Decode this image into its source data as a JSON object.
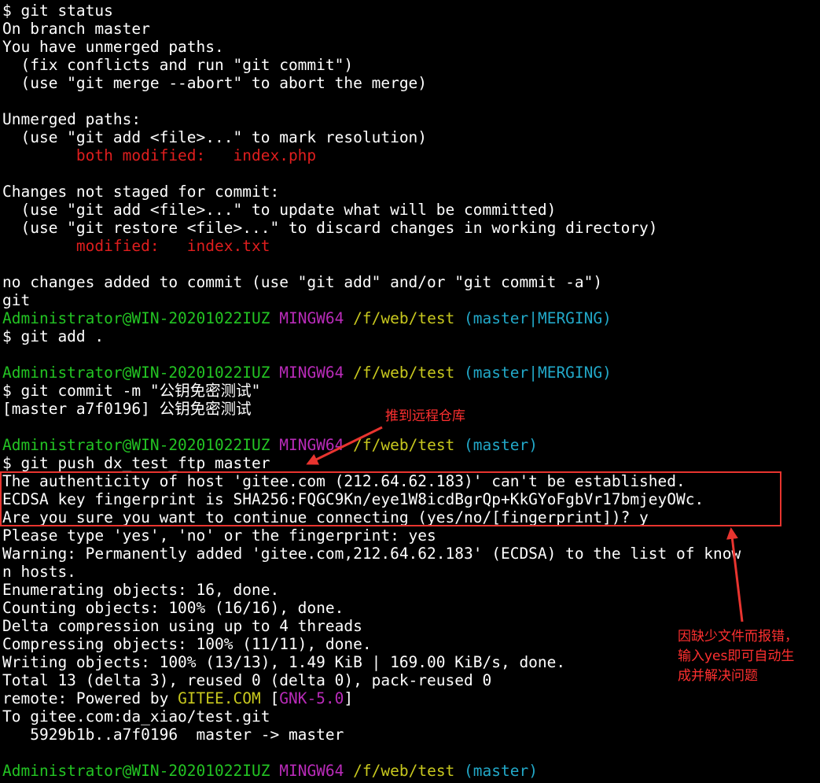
{
  "terminal": {
    "lines": [
      {
        "segments": [
          {
            "t": "$ git status",
            "c": ""
          }
        ]
      },
      {
        "segments": [
          {
            "t": "On branch master",
            "c": ""
          }
        ]
      },
      {
        "segments": [
          {
            "t": "You have unmerged paths.",
            "c": ""
          }
        ]
      },
      {
        "segments": [
          {
            "t": "  (fix conflicts and run \"git commit\")",
            "c": ""
          }
        ]
      },
      {
        "segments": [
          {
            "t": "  (use \"git merge --abort\" to abort the merge)",
            "c": ""
          }
        ]
      },
      {
        "segments": []
      },
      {
        "segments": [
          {
            "t": "Unmerged paths:",
            "c": ""
          }
        ]
      },
      {
        "segments": [
          {
            "t": "  (use \"git add <file>...\" to mark resolution)",
            "c": ""
          }
        ]
      },
      {
        "segments": [
          {
            "t": "        both modified:   index.php",
            "c": "red"
          }
        ]
      },
      {
        "segments": []
      },
      {
        "segments": [
          {
            "t": "Changes not staged for commit:",
            "c": ""
          }
        ]
      },
      {
        "segments": [
          {
            "t": "  (use \"git add <file>...\" to update what will be committed)",
            "c": ""
          }
        ]
      },
      {
        "segments": [
          {
            "t": "  (use \"git restore <file>...\" to discard changes in working directory)",
            "c": ""
          }
        ]
      },
      {
        "segments": [
          {
            "t": "        modified:   index.txt",
            "c": "red"
          }
        ]
      },
      {
        "segments": []
      },
      {
        "segments": [
          {
            "t": "no changes added to commit (use \"git add\" and/or \"git commit -a\")",
            "c": ""
          }
        ]
      },
      {
        "segments": [
          {
            "t": "git",
            "c": ""
          }
        ]
      },
      {
        "segments": [
          {
            "t": "Administrator@WIN-20201022IUZ",
            "c": "green"
          },
          {
            "t": " ",
            "c": ""
          },
          {
            "t": "MINGW64",
            "c": "magenta"
          },
          {
            "t": " ",
            "c": ""
          },
          {
            "t": "/f/web/test",
            "c": "yellow"
          },
          {
            "t": " ",
            "c": ""
          },
          {
            "t": "(master|MERGING)",
            "c": "cyan"
          }
        ]
      },
      {
        "segments": [
          {
            "t": "$ git add .",
            "c": ""
          }
        ]
      },
      {
        "segments": []
      },
      {
        "segments": [
          {
            "t": "Administrator@WIN-20201022IUZ",
            "c": "green"
          },
          {
            "t": " ",
            "c": ""
          },
          {
            "t": "MINGW64",
            "c": "magenta"
          },
          {
            "t": " ",
            "c": ""
          },
          {
            "t": "/f/web/test",
            "c": "yellow"
          },
          {
            "t": " ",
            "c": ""
          },
          {
            "t": "(master|MERGING)",
            "c": "cyan"
          }
        ]
      },
      {
        "segments": [
          {
            "t": "$ git commit -m \"公钥免密测试\"",
            "c": ""
          }
        ]
      },
      {
        "segments": [
          {
            "t": "[master a7f0196] 公钥免密测试",
            "c": ""
          }
        ]
      },
      {
        "segments": []
      },
      {
        "segments": [
          {
            "t": "Administrator@WIN-20201022IUZ",
            "c": "green"
          },
          {
            "t": " ",
            "c": ""
          },
          {
            "t": "MINGW64",
            "c": "magenta"
          },
          {
            "t": " ",
            "c": ""
          },
          {
            "t": "/f/web/test",
            "c": "yellow"
          },
          {
            "t": " ",
            "c": ""
          },
          {
            "t": "(master)",
            "c": "cyan"
          }
        ]
      },
      {
        "segments": [
          {
            "t": "$ git push dx_test_ftp master",
            "c": ""
          }
        ]
      },
      {
        "segments": [
          {
            "t": "The authenticity of host 'gitee.com (212.64.62.183)' can't be established.",
            "c": ""
          }
        ]
      },
      {
        "segments": [
          {
            "t": "ECDSA key fingerprint is SHA256:FQGC9Kn/eye1W8icdBgrQp+KkGYoFgbVr17bmjeyOWc.",
            "c": ""
          }
        ]
      },
      {
        "segments": [
          {
            "t": "Are you sure you want to continue connecting (yes/no/[fingerprint])? y",
            "c": ""
          }
        ]
      },
      {
        "segments": [
          {
            "t": "Please type 'yes', 'no' or the fingerprint: yes",
            "c": ""
          }
        ]
      },
      {
        "segments": [
          {
            "t": "Warning: Permanently added 'gitee.com,212.64.62.183' (ECDSA) to the list of know",
            "c": ""
          }
        ]
      },
      {
        "segments": [
          {
            "t": "n hosts.",
            "c": ""
          }
        ]
      },
      {
        "segments": [
          {
            "t": "Enumerating objects: 16, done.",
            "c": ""
          }
        ]
      },
      {
        "segments": [
          {
            "t": "Counting objects: 100% (16/16), done.",
            "c": ""
          }
        ]
      },
      {
        "segments": [
          {
            "t": "Delta compression using up to 4 threads",
            "c": ""
          }
        ]
      },
      {
        "segments": [
          {
            "t": "Compressing objects: 100% (11/11), done.",
            "c": ""
          }
        ]
      },
      {
        "segments": [
          {
            "t": "Writing objects: 100% (13/13), 1.49 KiB | 169.00 KiB/s, done.",
            "c": ""
          }
        ]
      },
      {
        "segments": [
          {
            "t": "Total 13 (delta 3), reused 0 (delta 0), pack-reused 0",
            "c": ""
          }
        ]
      },
      {
        "segments": [
          {
            "t": "remote: Powered by ",
            "c": ""
          },
          {
            "t": "GITEE.COM",
            "c": "yellow"
          },
          {
            "t": " [",
            "c": ""
          },
          {
            "t": "GNK-5.0",
            "c": "magenta"
          },
          {
            "t": "]",
            "c": ""
          }
        ]
      },
      {
        "segments": [
          {
            "t": "To gitee.com:da_xiao/test.git",
            "c": ""
          }
        ]
      },
      {
        "segments": [
          {
            "t": "   5929b1b..a7f0196  master -> master",
            "c": ""
          }
        ]
      },
      {
        "segments": []
      },
      {
        "segments": [
          {
            "t": "Administrator@WIN-20201022IUZ",
            "c": "green"
          },
          {
            "t": " ",
            "c": ""
          },
          {
            "t": "MINGW64",
            "c": "magenta"
          },
          {
            "t": " ",
            "c": ""
          },
          {
            "t": "/f/web/test",
            "c": "yellow"
          },
          {
            "t": " ",
            "c": ""
          },
          {
            "t": "(master)",
            "c": "cyan"
          }
        ]
      }
    ]
  },
  "annotations": {
    "push_note": "推到远程仓库",
    "yes_note": "因缺少文件而报错，\n输入yes即可自动生\n成并解决问题"
  },
  "colors": {
    "background": "#000000",
    "text": "#ffffff",
    "red": "#df1e1e",
    "green": "#23c423",
    "magenta": "#b92bb9",
    "yellow": "#c8c81e",
    "cyan": "#22a8c8",
    "annotation": "#e8342f"
  }
}
